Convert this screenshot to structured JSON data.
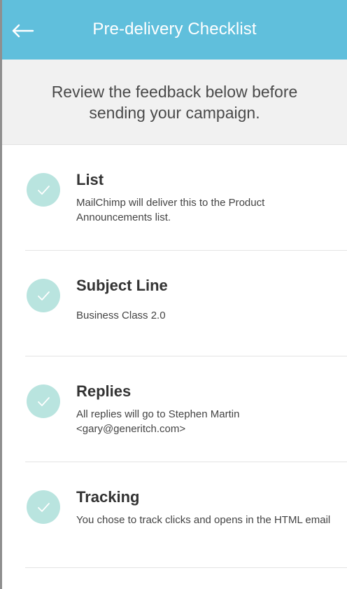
{
  "header": {
    "back_icon": "arrow-left-icon",
    "title": "Pre-delivery Checklist",
    "background_color": "#60bfdc"
  },
  "intro": {
    "text": "Review the feedback below before sending your campaign."
  },
  "checklist": {
    "status_color": "#b9e4df",
    "items": [
      {
        "icon": "check-icon",
        "title": "List",
        "description": "MailChimp will deliver this to the Product Announcements list."
      },
      {
        "icon": "check-icon",
        "title": "Subject Line",
        "description": "Business Class 2.0"
      },
      {
        "icon": "check-icon",
        "title": "Replies",
        "description": "All replies will go to Stephen Martin <gary@generitch.com>"
      },
      {
        "icon": "check-icon",
        "title": "Tracking",
        "description": "You chose to track clicks and opens in the HTML email"
      }
    ]
  }
}
